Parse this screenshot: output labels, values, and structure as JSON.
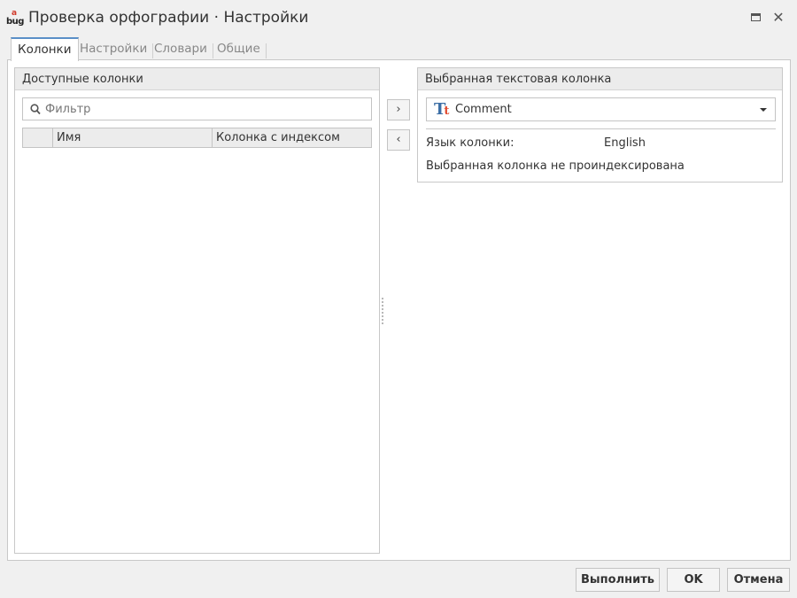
{
  "window": {
    "title": "Проверка орфографии · Настройки",
    "app_icon_top": "a",
    "app_icon_bottom": "bug"
  },
  "tabs": [
    {
      "label": "Колонки",
      "active": true
    },
    {
      "label": "Настройки",
      "active": false
    },
    {
      "label": "Словари",
      "active": false
    },
    {
      "label": "Общие",
      "active": false
    }
  ],
  "left_panel": {
    "title": "Доступные колонки",
    "filter_placeholder": "Фильтр",
    "grid_columns": [
      "",
      "Имя",
      "Колонка с индексом"
    ],
    "rows": []
  },
  "move_buttons": {
    "add": "›",
    "remove": "‹"
  },
  "right_panel": {
    "title": "Выбранная текстовая колонка",
    "selected_column": "Comment",
    "language_label": "Язык колонки:",
    "language_value": "English",
    "status": "Выбранная колонка не проиндексирована"
  },
  "footer": {
    "run": "Выполнить",
    "ok": "OK",
    "cancel": "Отмена"
  },
  "colors": {
    "accent": "#5a8fc7",
    "icon_blue": "#3d6fa6",
    "icon_red": "#e04a2f"
  },
  "icons": {
    "app": "bug-app-icon",
    "maximize": "maximize-icon",
    "close": "close-icon",
    "filter": "search-icon",
    "column_type": "text-type-icon",
    "dropdown": "chevron-down-icon"
  }
}
